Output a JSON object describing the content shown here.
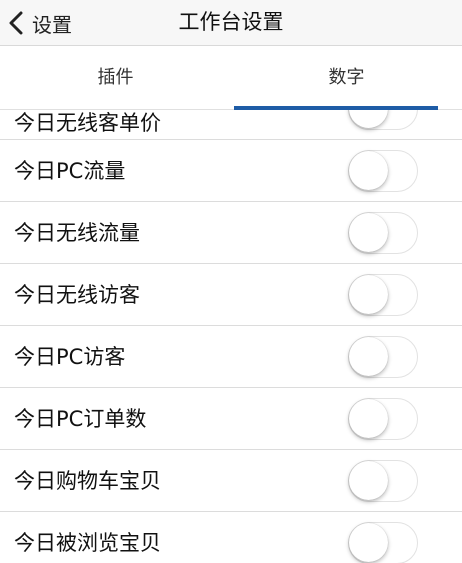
{
  "nav": {
    "back_label": "设置",
    "title": "工作台设置"
  },
  "tabs": [
    {
      "label": "插件",
      "active": false
    },
    {
      "label": "数字",
      "active": true
    }
  ],
  "accent_color": "#1e5ca6",
  "rows": [
    {
      "label": "今日无线客单价",
      "enabled": false
    },
    {
      "label": "今日PC流量",
      "enabled": false
    },
    {
      "label": "今日无线流量",
      "enabled": false
    },
    {
      "label": "今日无线访客",
      "enabled": false
    },
    {
      "label": "今日PC访客",
      "enabled": false
    },
    {
      "label": "今日PC订单数",
      "enabled": false
    },
    {
      "label": "今日购物车宝贝",
      "enabled": false
    },
    {
      "label": "今日被浏览宝贝",
      "enabled": false
    }
  ]
}
